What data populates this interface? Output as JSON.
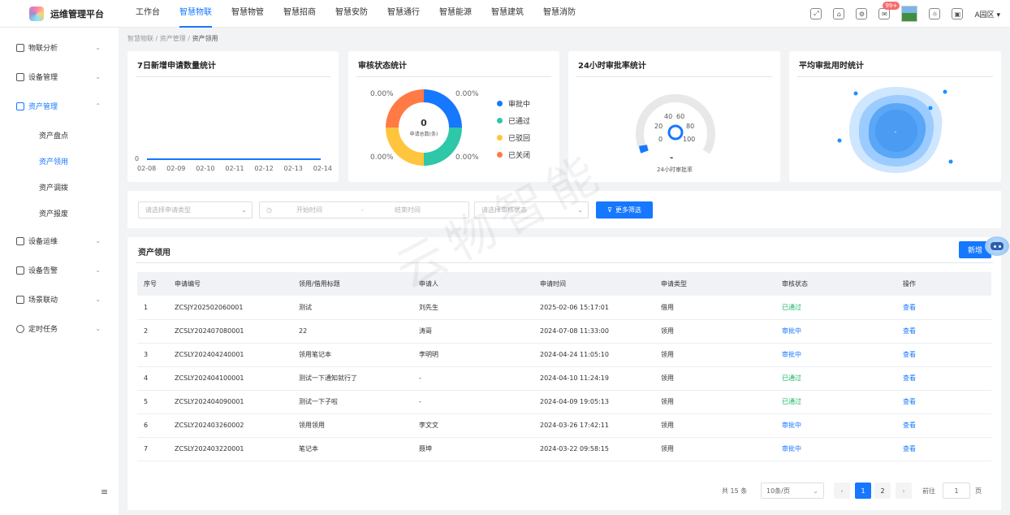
{
  "app": {
    "title": "运维管理平台"
  },
  "topnav": [
    {
      "label": "工作台",
      "active": false
    },
    {
      "label": "智慧物联",
      "active": true
    },
    {
      "label": "智慧物管",
      "active": false
    },
    {
      "label": "智慧招商",
      "active": false
    },
    {
      "label": "智慧安防",
      "active": false
    },
    {
      "label": "智慧通行",
      "active": false
    },
    {
      "label": "智慧能源",
      "active": false
    },
    {
      "label": "智慧建筑",
      "active": false
    },
    {
      "label": "智慧消防",
      "active": false
    }
  ],
  "topright": {
    "mail_badge": "99+",
    "area": "A园区"
  },
  "sidebar": {
    "items": [
      {
        "label": "物联分析"
      },
      {
        "label": "设备管理"
      },
      {
        "label": "资产管理",
        "expanded": true
      },
      {
        "label": "设备运维"
      },
      {
        "label": "设备告警"
      },
      {
        "label": "场景联动"
      },
      {
        "label": "定时任务"
      }
    ],
    "sub_items": [
      {
        "label": "资产盘点",
        "active": false
      },
      {
        "label": "资产领用",
        "active": true
      },
      {
        "label": "资产调拨",
        "active": false
      },
      {
        "label": "资产报废",
        "active": false
      }
    ]
  },
  "breadcrumb": [
    "智慧物联",
    "资产管理",
    "资产领用"
  ],
  "cards": {
    "new_requests": {
      "title": "7日新增申请数量统计",
      "y_tick": "0",
      "x_ticks": [
        "02-08",
        "02-09",
        "02-10",
        "02-11",
        "02-12",
        "02-13",
        "02-14"
      ]
    },
    "audit_status": {
      "title": "审核状态统计",
      "center_value": "0",
      "center_label": "申请总数(条)",
      "percent_labels": [
        "0.00%",
        "0.00%",
        "0.00%",
        "0.00%"
      ],
      "legend": [
        {
          "label": "审批中",
          "color": "#1677ff"
        },
        {
          "label": "已通过",
          "color": "#2ec7a7"
        },
        {
          "label": "已驳回",
          "color": "#ffc53d"
        },
        {
          "label": "已关闭",
          "color": "#ff7a45"
        }
      ]
    },
    "approval_rate": {
      "title": "24小时审批率统计",
      "ticks": [
        "0",
        "20",
        "40",
        "60",
        "80",
        "100"
      ],
      "value": "-",
      "caption": "24小时审批率"
    },
    "avg_time": {
      "title": "平均审批用时统计",
      "center_value": "-"
    }
  },
  "filter": {
    "type_placeholder": "请选择申请类型",
    "start_placeholder": "开始时间",
    "sep": "-",
    "end_placeholder": "结束时间",
    "status_placeholder": "请选择审核状态",
    "more_label": "更多筛选"
  },
  "table": {
    "title": "资产领用",
    "new_label": "新增",
    "columns": [
      "序号",
      "申请编号",
      "领用/借用标题",
      "申请人",
      "申请时间",
      "申请类型",
      "审核状态",
      "操作"
    ],
    "rows": [
      {
        "no": "1",
        "code": "ZCSJY202502060001",
        "title": "测试",
        "applicant": "刘先生",
        "time": "2025-02-06 15:17:01",
        "type": "借用",
        "status": "已通过",
        "op": "查看"
      },
      {
        "no": "2",
        "code": "ZCSLY202407080001",
        "title": "22",
        "applicant": "涛哥",
        "time": "2024-07-08 11:33:00",
        "type": "领用",
        "status": "审批中",
        "op": "查看"
      },
      {
        "no": "3",
        "code": "ZCSLY202404240001",
        "title": "领用笔记本",
        "applicant": "李明明",
        "time": "2024-04-24 11:05:10",
        "type": "领用",
        "status": "审批中",
        "op": "查看"
      },
      {
        "no": "4",
        "code": "ZCSLY202404100001",
        "title": "测试一下通知就行了",
        "applicant": "-",
        "time": "2024-04-10 11:24:19",
        "type": "领用",
        "status": "已通过",
        "op": "查看"
      },
      {
        "no": "5",
        "code": "ZCSLY202404090001",
        "title": "测试一下子啦",
        "applicant": "-",
        "time": "2024-04-09 19:05:13",
        "type": "领用",
        "status": "已通过",
        "op": "查看"
      },
      {
        "no": "6",
        "code": "ZCSLY202403260002",
        "title": "领用领用",
        "applicant": "李文文",
        "time": "2024-03-26 17:42:11",
        "type": "领用",
        "status": "审批中",
        "op": "查看"
      },
      {
        "no": "7",
        "code": "ZCSLY202403220001",
        "title": "笔记本",
        "applicant": "聂坤",
        "time": "2024-03-22 09:58:15",
        "type": "领用",
        "status": "审批中",
        "op": "查看"
      }
    ]
  },
  "pager": {
    "total": "共 15 条",
    "size": "10条/页",
    "pages": [
      "1",
      "2"
    ],
    "goto_label": "前往",
    "goto_value": "1",
    "page_unit": "页"
  },
  "watermark": "云物智能",
  "colors": {
    "accent": "#1677ff",
    "success": "#18b566"
  }
}
